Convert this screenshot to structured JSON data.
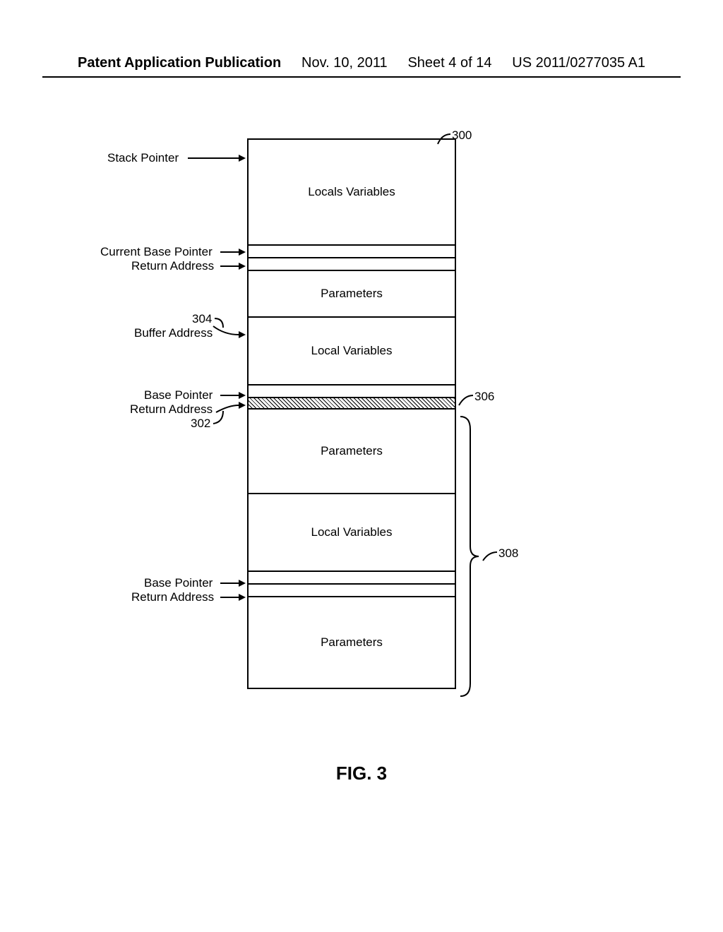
{
  "header": {
    "left": "Patent Application Publication",
    "date": "Nov. 10, 2011",
    "sheet": "Sheet 4 of 14",
    "docnum": "US 2011/0277035 A1"
  },
  "stack": {
    "ref_300": "300",
    "ref_304": "304",
    "ref_302": "302",
    "ref_306": "306",
    "ref_308": "308",
    "cells": {
      "locals_top": "Locals Variables",
      "parameters_1": "Parameters",
      "local_vars_1": "Local Variables",
      "parameters_2": "Parameters",
      "local_vars_2": "Local Variables",
      "parameters_3": "Parameters"
    },
    "labels": {
      "stack_pointer": "Stack Pointer",
      "current_base_pointer": "Current Base Pointer",
      "return_address_1": "Return Address",
      "buffer_address": "Buffer Address",
      "base_pointer_1": "Base Pointer",
      "return_address_2": "Return Address",
      "base_pointer_2": "Base Pointer",
      "return_address_3": "Return Address"
    }
  },
  "figure_caption": "FIG. 3"
}
